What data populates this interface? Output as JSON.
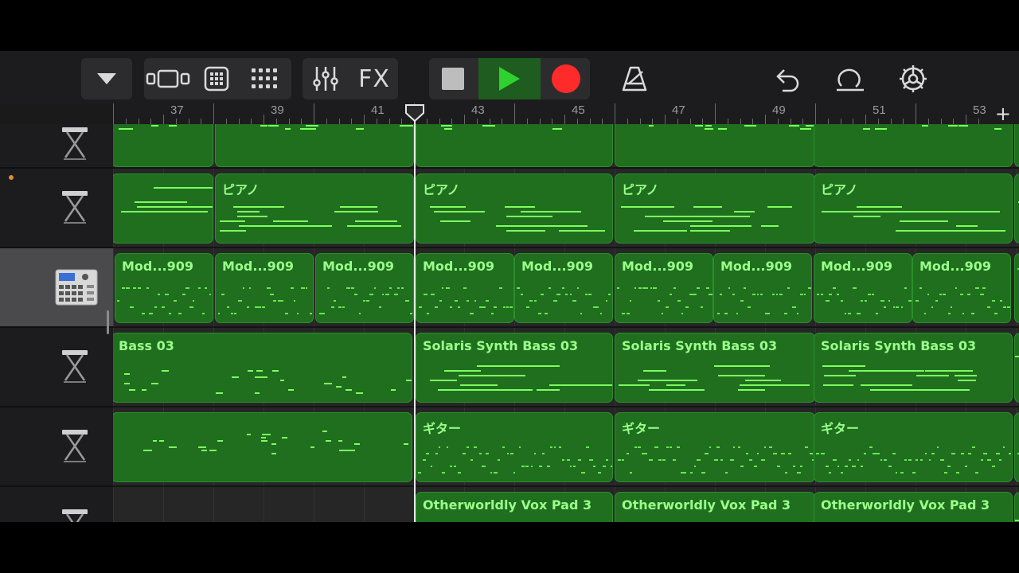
{
  "toolbar": {
    "buttons": [
      {
        "name": "browser-dropdown-button",
        "icon": "triangle-down-icon"
      },
      {
        "name": "tracks-view-button",
        "icon": "tracks-view-icon"
      },
      {
        "name": "grid-view-button",
        "icon": "grid-icon"
      },
      {
        "name": "live-loops-button",
        "icon": "dots-grid-icon"
      },
      {
        "name": "mixer-button",
        "icon": "sliders-icon"
      },
      {
        "name": "fx-button",
        "label": "FX"
      },
      {
        "name": "stop-button",
        "icon": "stop-icon"
      },
      {
        "name": "play-button",
        "icon": "play-icon"
      },
      {
        "name": "record-button",
        "icon": "record-icon"
      },
      {
        "name": "metronome-button",
        "icon": "metronome-icon"
      },
      {
        "name": "undo-button",
        "icon": "undo-icon"
      },
      {
        "name": "loop-button",
        "icon": "loop-icon"
      },
      {
        "name": "settings-button",
        "icon": "gear-icon"
      }
    ],
    "fx_label": "FX",
    "colors": {
      "play": "#2fd12f",
      "record": "#ff2a2a",
      "stop": "#bdbdbd"
    }
  },
  "ruler": {
    "bars": [
      "37",
      "39",
      "41",
      "43",
      "45",
      "47",
      "49",
      "51",
      "53"
    ],
    "add_label": "+"
  },
  "tracks": [
    {
      "name": "keyboard-track-1",
      "icon": "keyboard-stand-icon"
    },
    {
      "name": "piano-track",
      "icon": "keyboard-stand-icon",
      "armed": true
    },
    {
      "name": "drum-machine-track",
      "icon": "drum-machine-icon",
      "selected": true
    },
    {
      "name": "bass-track",
      "icon": "keyboard-stand-icon"
    },
    {
      "name": "guitar-track",
      "icon": "keyboard-stand-icon"
    },
    {
      "name": "pad-track",
      "icon": "keyboard-stand-icon"
    }
  ],
  "regions": {
    "piano": [
      "ピアノ",
      "ピアノ",
      "ピアノ",
      "ピアノ"
    ],
    "drums": [
      "Mod...909",
      "Mod...909",
      "Mod...909",
      "Mod...909",
      "Mod...909",
      "Mod...909",
      "Mod...909",
      "Mod...909",
      "Mod...909"
    ],
    "bass": [
      "Bass 03",
      "Solaris Synth Bass 03",
      "Solaris Synth Bass 03",
      "Solaris Synth Bass 03"
    ],
    "guitar": [
      "ギター",
      "ギター",
      "ギター"
    ],
    "pad": [
      "Otherworldly Vox Pad 3",
      "Otherworldly Vox Pad 3",
      "Otherworldly Vox Pad 3"
    ]
  }
}
